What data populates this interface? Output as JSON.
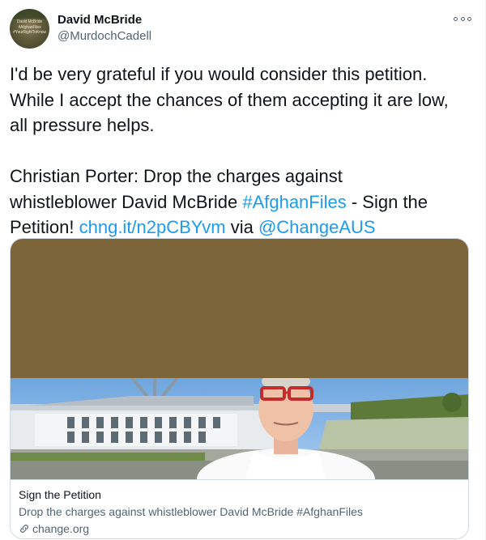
{
  "author": {
    "name": "David McBride",
    "handle": "@MurdochCadell",
    "avatar_text": "David McBride\n#AfghanFiles\n#YourRightToKnow"
  },
  "tweet": {
    "line1": "I'd be very grateful if you would consider this petition.",
    "line2": "While I accept the chances of them accepting it are low,",
    "line3": "all pressure helps.",
    "para2_text_a": "Christian Porter: Drop the charges against",
    "para2_text_b": "whistleblower David McBride ",
    "hashtag": "#AfghanFiles",
    "para2_text_c": " - Sign the",
    "para2_text_d": "Petition! ",
    "short_link": "chng.it/n2pCBYvm",
    "via_text": " via ",
    "mention": "@ChangeAUS"
  },
  "card": {
    "title": "Sign the Petition",
    "description": "Drop the charges against whistleblower David McBride #AfghanFiles",
    "domain": "change.org",
    "image_top_color": "#7b6539"
  },
  "colors": {
    "link": "#1d9bf0",
    "secondary_text": "#536471",
    "border": "#cfd9de"
  },
  "icons": {
    "more": "more-horizontal-icon",
    "link": "link-icon"
  }
}
